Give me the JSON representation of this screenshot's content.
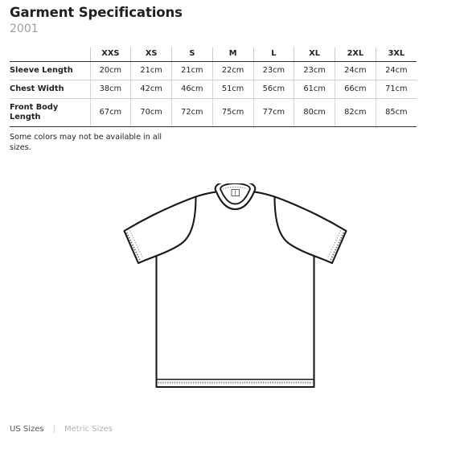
{
  "header": {
    "title": "Garment Specifications",
    "product_code": "2001"
  },
  "spec_table": {
    "corner_label": "",
    "sizes": [
      "XXS",
      "XS",
      "S",
      "M",
      "L",
      "XL",
      "2XL",
      "3XL"
    ],
    "rows": [
      {
        "label": "Sleeve Length",
        "values": [
          "20cm",
          "21cm",
          "21cm",
          "22cm",
          "23cm",
          "23cm",
          "24cm",
          "24cm"
        ]
      },
      {
        "label": "Chest Width",
        "values": [
          "38cm",
          "42cm",
          "46cm",
          "51cm",
          "56cm",
          "61cm",
          "66cm",
          "71cm"
        ]
      },
      {
        "label": "Front Body Length",
        "values": [
          "67cm",
          "70cm",
          "72cm",
          "75cm",
          "77cm",
          "80cm",
          "82cm",
          "85cm"
        ]
      }
    ]
  },
  "note": "Some colors may not be available in all sizes.",
  "illustration": {
    "name": "t-shirt-front-view"
  },
  "footer": {
    "us_sizes_label": "US Sizes",
    "separator": "|",
    "metric_sizes_label": "Metric Sizes"
  },
  "colors": {
    "text": "#231f20",
    "muted": "#9d9d9d",
    "rule_strong": "#333333",
    "rule_light": "#cfcfcf",
    "footer_active": "#58545a",
    "footer_inactive": "#b3b0b6"
  }
}
